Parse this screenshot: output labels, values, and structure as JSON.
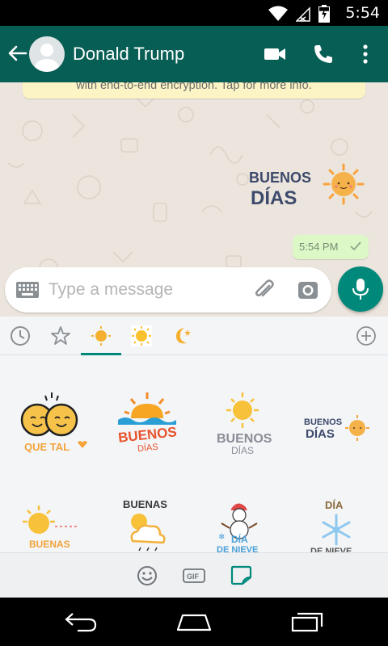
{
  "status": {
    "time": "5:54",
    "battery_level": 0.7
  },
  "toolbar": {
    "contact_name": "Donald Trump"
  },
  "chat": {
    "encryption_notice": "with end-to-end encryption. Tap for more info.",
    "message_time": "5:54 PM",
    "sent_sticker_line1": "BUENOS",
    "sent_sticker_line2": "DÍAS"
  },
  "input": {
    "placeholder": "Type a message"
  },
  "stickers": [
    {
      "l1": "QUE TAL",
      "l2": ""
    },
    {
      "l1": "BUENOS",
      "l2": "DÍAS"
    },
    {
      "l1": "BUENOS",
      "l2": "DÍAS"
    },
    {
      "l1": "BUENOS",
      "l2": "DÍAS"
    },
    {
      "l1": "BUENAS",
      "l2": ""
    },
    {
      "l1": "BUENAS",
      "l2": ""
    },
    {
      "l1": "DÍA",
      "l2": "DE NIEVE"
    },
    {
      "l1": "DÍA",
      "l2": "DE NIEVE"
    }
  ],
  "bottom_bar": {
    "gif_label": "GIF"
  },
  "colors": {
    "toolbar": "#075e54",
    "accent": "#00897b",
    "bubble": "#dcf8c6",
    "chat_bg": "#ece5dd"
  }
}
